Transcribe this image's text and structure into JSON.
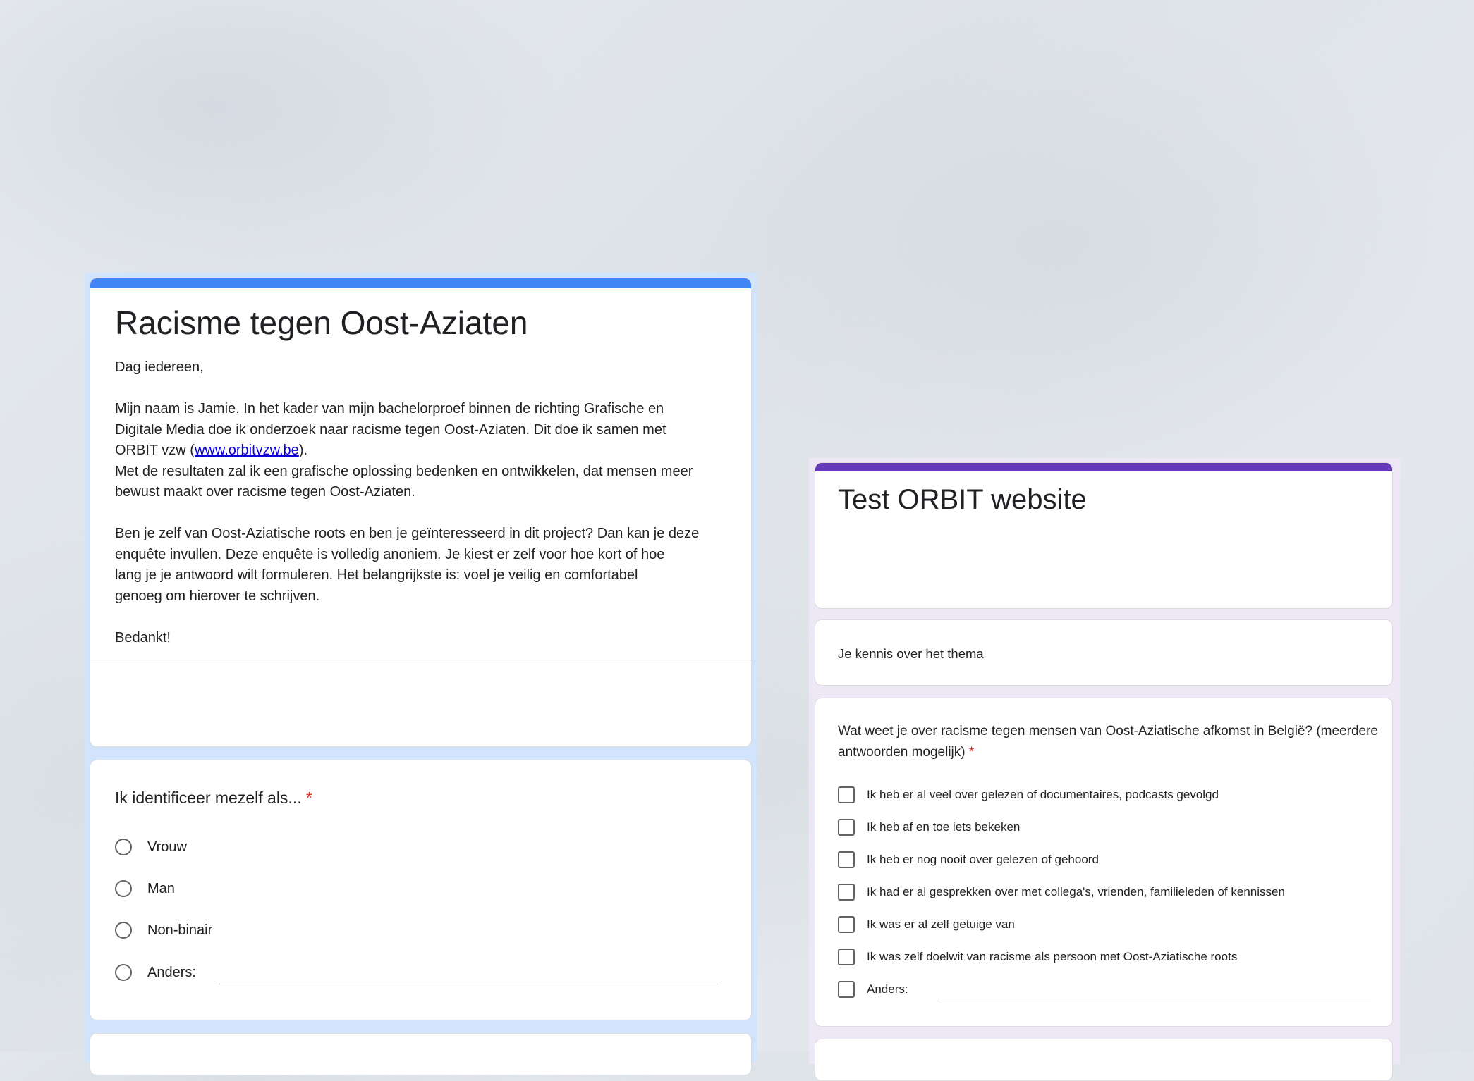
{
  "left_form": {
    "title": "Racisme tegen Oost-Aziaten",
    "description": {
      "greeting": "Dag iedereen,",
      "p1_line1": "Mijn naam is Jamie. In het kader van mijn bachelorproef binnen de richting Grafische en",
      "p1_line2": "Digitale Media doe ik onderzoek naar racisme tegen Oost-Aziaten. Dit doe ik samen met",
      "p1_line3_pre": "ORBIT vzw (",
      "link_text": "www.orbitvzw.be",
      "p1_line3_post": ").",
      "p2_line1": "Met de resultaten zal ik een grafische oplossing bedenken en ontwikkelen, dat mensen meer",
      "p2_line2": "bewust maakt over racisme tegen Oost-Aziaten.",
      "p3_line1": "Ben je zelf van Oost-Aziatische roots en ben je geïnteresseerd in dit project? Dan kan je deze",
      "p3_line2": "enquête invullen. Deze enquête is volledig anoniem. Je kiest er zelf voor hoe kort of hoe",
      "p3_line3": "lang je je antwoord wilt formuleren. Het belangrijkste is: voel je veilig en comfortabel",
      "p3_line4": "genoeg om hierover te schrijven.",
      "closing": "Bedankt!"
    },
    "question": {
      "title": "Ik identificeer mezelf als...",
      "required_mark": "*",
      "options": [
        "Vrouw",
        "Man",
        "Non-binair",
        "Anders:"
      ]
    }
  },
  "right_form": {
    "title": "Test ORBIT website",
    "section_title": "Je kennis over het thema",
    "question": {
      "title": "Wat weet je over racisme tegen mensen van Oost-Aziatische afkomst in België? (meerdere antwoorden mogelijk)",
      "required_mark": "*",
      "options": [
        "Ik heb er al veel over gelezen of documentaires, podcasts gevolgd",
        "Ik heb af en toe iets bekeken",
        "Ik heb er nog nooit over gelezen of gehoord",
        "Ik had er al gesprekken over met collega's, vrienden, familieleden of kennissen",
        "Ik was er al zelf getuige van",
        "Ik was zelf doelwit van racisme als persoon met Oost-Aziatische roots",
        "Anders:"
      ]
    }
  },
  "colors": {
    "left_accent": "#4285f4",
    "left_background": "#d2e3fc",
    "right_accent": "#673ab7",
    "right_background": "#ede7f6",
    "required": "#d93025"
  }
}
